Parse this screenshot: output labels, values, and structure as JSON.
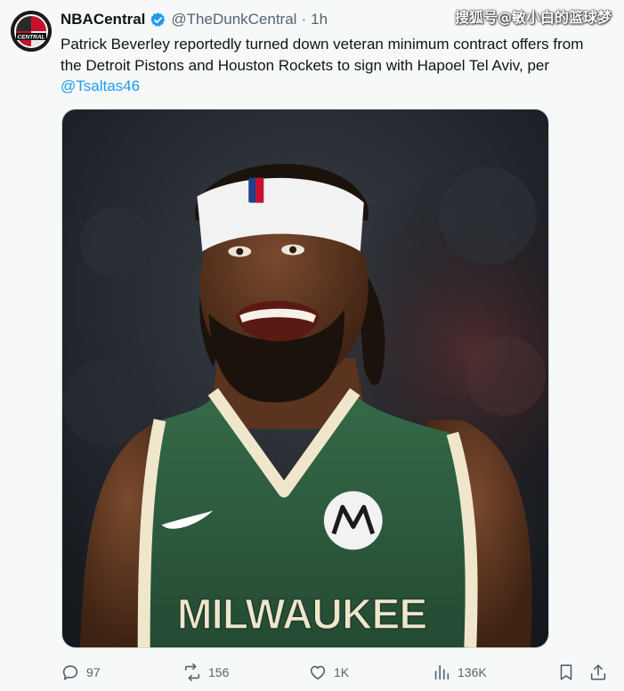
{
  "tweet": {
    "author_name": "NBACentral",
    "handle": "@TheDunkCentral",
    "separator": "·",
    "time": "1h",
    "avatar_text": "CENTRAL",
    "text_before": "Patrick Beverley reportedly turned down veteran minimum contract offers from the Detroit Pistons and Houston Rockets to sign with Hapoel Tel Aviv, per ",
    "mention": "@Tsaltas46",
    "verified_icon": "verified-badge-icon"
  },
  "watermark": "搜狐号@敏小白的篮球梦",
  "media": {
    "jersey_text": "MILWAUKEE",
    "colors": {
      "jersey": "#2d5a3e",
      "trim": "#efe6cc",
      "headband": "#f2f2f2",
      "background": "#1d2127"
    }
  },
  "actions": {
    "replies": "97",
    "retweets": "156",
    "likes": "1K",
    "views": "136K"
  },
  "colors": {
    "accent": "#1d9bf0",
    "muted": "#536471",
    "text": "#0f1419"
  }
}
